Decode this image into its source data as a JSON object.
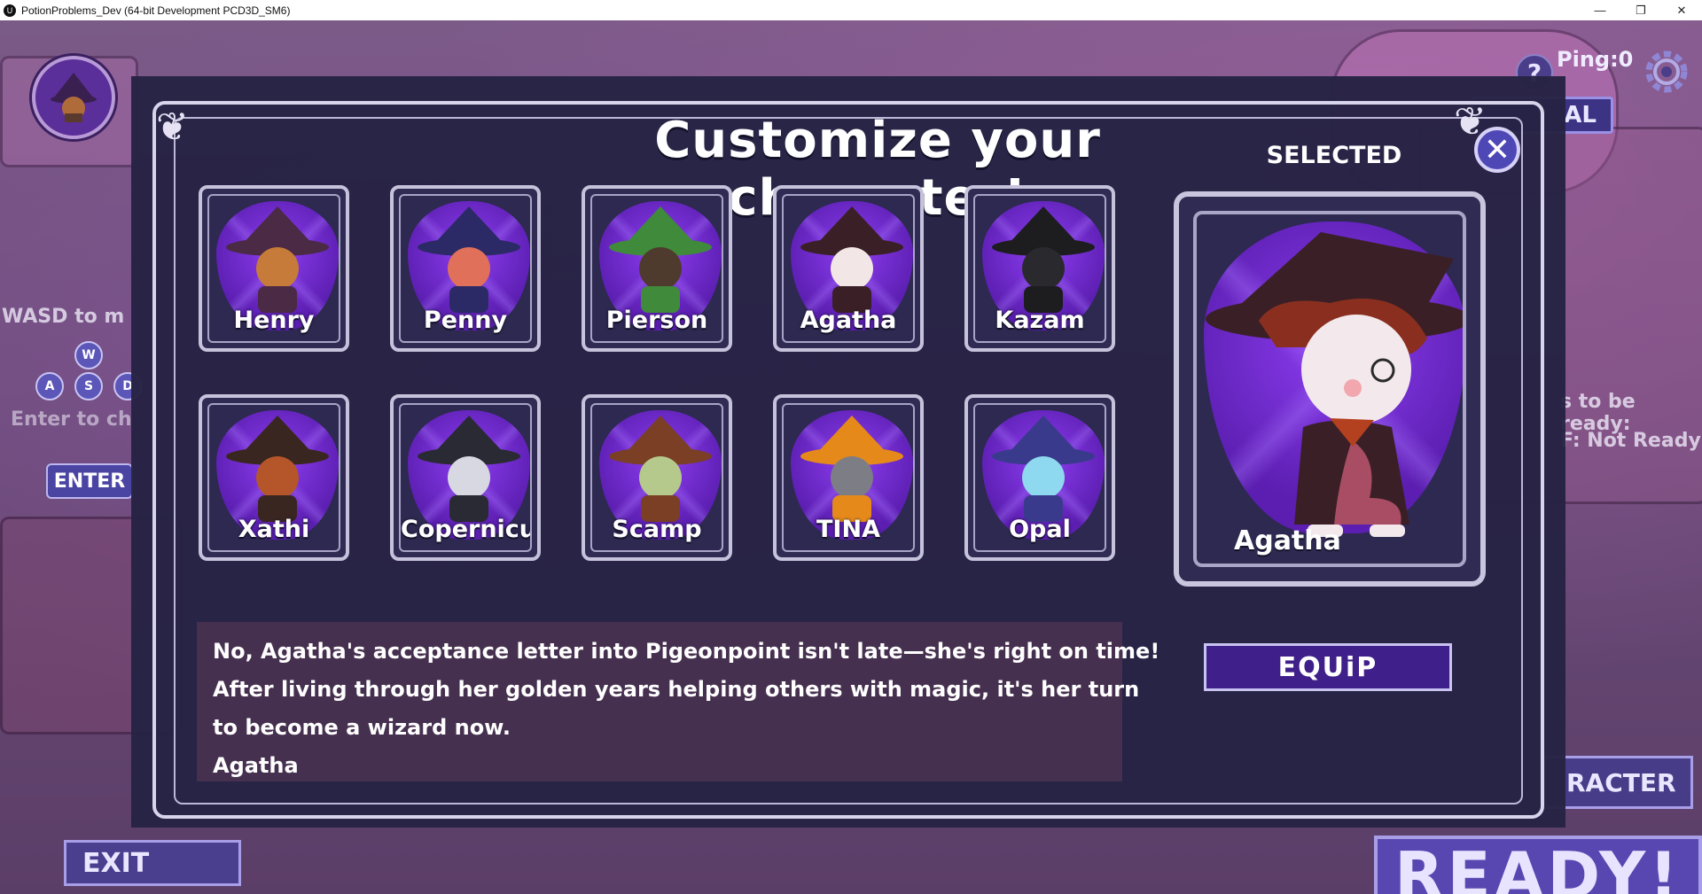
{
  "window": {
    "title": "PotionProblems_Dev (64-bit Development PCD3D_SM6)",
    "controls": [
      "—",
      "❐",
      "✕"
    ]
  },
  "hud": {
    "ping_label": "Ping:0",
    "help_glyph": "?",
    "tutorial_label": "AL",
    "controls_hint": "WASD to m",
    "wasd_keys": [
      "W",
      "A",
      "S",
      "D"
    ],
    "enter_hint": "Enter to ch",
    "enter_key": "ENTER",
    "ready_hint_1": "s to be ready:",
    "ready_hint_2": "F: Not Ready",
    "exit_label": "EXIT",
    "character_label": "RACTER",
    "ready_label": "READY!"
  },
  "modal": {
    "title": "Customize  your character!",
    "selected_label": "SELECTED",
    "close_glyph": "✕",
    "characters": [
      {
        "name": "Henry",
        "hat": "#4a2a44",
        "body": "#c77b3a"
      },
      {
        "name": "Penny",
        "hat": "#2c2a66",
        "body": "#e0705a"
      },
      {
        "name": "Pierson",
        "hat": "#3f8a3b",
        "body": "#4f3a2e"
      },
      {
        "name": "Agatha",
        "hat": "#3a2026",
        "body": "#f2e6e6"
      },
      {
        "name": "Kazam",
        "hat": "#1d1d20",
        "body": "#2a2a2e"
      },
      {
        "name": "Xathi",
        "hat": "#3a2620",
        "body": "#b5562a"
      },
      {
        "name": "Copernicus",
        "hat": "#2a2a34",
        "body": "#d8d8e2"
      },
      {
        "name": "Scamp",
        "hat": "#7a3f24",
        "body": "#b6c98c"
      },
      {
        "name": "TINA",
        "hat": "#e58a1a",
        "body": "#7d7d86"
      },
      {
        "name": "Opal",
        "hat": "#3a3a8c",
        "body": "#8ed8f0"
      }
    ],
    "selected_character": {
      "name": "Agatha"
    },
    "description_lines": [
      "No, Agatha's acceptance letter into Pigeonpoint isn't late—she's right on time!",
      "After living through her golden years helping others with magic, it's her turn",
      "to become a wizard now.",
      "Agatha"
    ],
    "equip_label": "EQUiP"
  },
  "colors": {
    "modal_bg": "#262344",
    "accent": "#4e47b6",
    "equip_bg": "#3f1f8a",
    "desc_bg": "#46304f"
  }
}
